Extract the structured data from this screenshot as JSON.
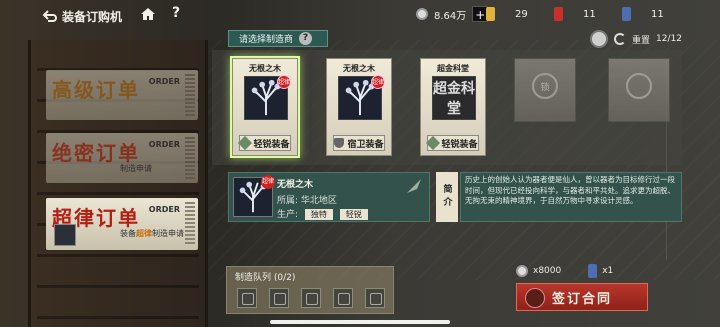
{
  "header": {
    "back_label": "装备订购机",
    "currency": "8.64万",
    "res1": "29",
    "res2": "11",
    "res3": "11"
  },
  "orders": [
    {
      "title": "高级订单",
      "tag": "ORDER",
      "sub": "",
      "sub_hi": ""
    },
    {
      "title": "绝密订单",
      "tag": "ORDER",
      "sub_pre": "",
      "sub_hi": "",
      "sub_post": "制造申请"
    },
    {
      "title": "超律订单",
      "tag": "ORDER",
      "sub_pre": "装备",
      "sub_hi": "超律",
      "sub_post": "制造申请"
    }
  ],
  "select_label": "请选择制造商",
  "reset": {
    "label": "重置",
    "count": "12/12"
  },
  "makers": [
    {
      "name": "无根之木",
      "badge": "超律",
      "type": "轻锐装备"
    },
    {
      "name": "无根之木",
      "badge": "超律",
      "type": "宿卫装备"
    },
    {
      "name": "超金科堂",
      "img_text": "超金科堂",
      "type": "轻锐装备"
    }
  ],
  "locked": [
    "锁",
    "锁"
  ],
  "detail": {
    "name": "无根之木",
    "badge": "超律",
    "region_label": "所属:",
    "region": "华北地区",
    "prod_label": "生产:",
    "prod1": "独特",
    "prod2": "轻锐"
  },
  "intro": {
    "label": "简介",
    "text": "历史上的创始人认为器者便是仙人，曾以器者为目标修行过一段时间，但现代已经投向科学，与器者和平共处。追求更为超脱、无拘无束的精神境界，于自然万物中寻求设计灵感。"
  },
  "queue": {
    "title": "制造队列",
    "count": "(0/2)"
  },
  "cost": {
    "coin": "x8000",
    "ticket": "x1"
  },
  "sign_button": "签订合同"
}
